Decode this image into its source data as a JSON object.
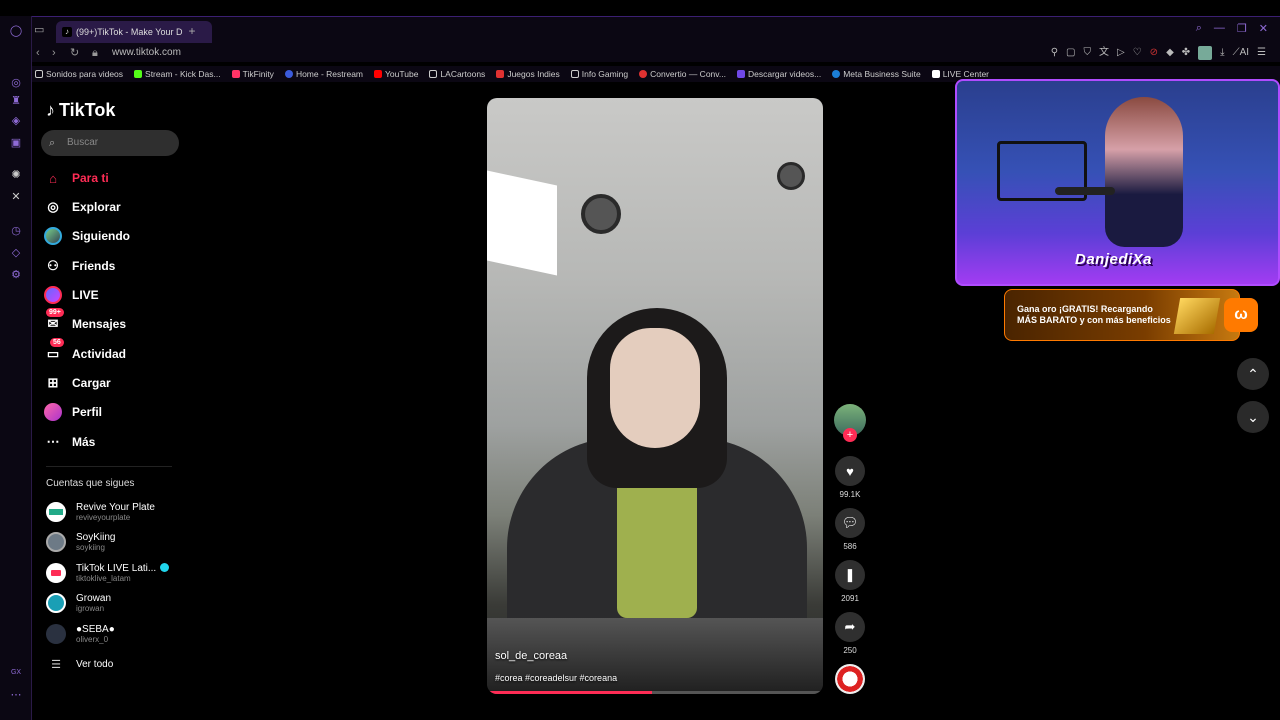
{
  "browser": {
    "tab_title": "(99+)TikTok - Make Your D",
    "url": "www.tiktok.com",
    "ai_label": "AI",
    "bookmarks": [
      {
        "label": "Sonidos para videos",
        "color": "#ccc"
      },
      {
        "label": "Stream - Kick Das...",
        "color": "#53fc18"
      },
      {
        "label": "TikFinity",
        "color": "#ff3366"
      },
      {
        "label": "Home - Restream",
        "color": "#3b5bdb"
      },
      {
        "label": "YouTube",
        "color": "#ff0000"
      },
      {
        "label": "LACartoons",
        "color": "#ccc"
      },
      {
        "label": "Juegos Indies",
        "color": "#e03131"
      },
      {
        "label": "Info Gaming",
        "color": "#ccc"
      },
      {
        "label": "Convertio — Conv...",
        "color": "#e03131"
      },
      {
        "label": "Descargar videos...",
        "color": "#7048e8"
      },
      {
        "label": "Meta Business Suite",
        "color": "#1c7ed6"
      },
      {
        "label": "LIVE Center",
        "color": "#ccc"
      }
    ]
  },
  "sidebar": {
    "logo": "TikTok",
    "search_placeholder": "Buscar",
    "nav": [
      {
        "label": "Para ti",
        "icon": "home-icon"
      },
      {
        "label": "Explorar",
        "icon": "compass-icon"
      },
      {
        "label": "Siguiendo",
        "icon": "following-avatar"
      },
      {
        "label": "Friends",
        "icon": "friends-icon"
      },
      {
        "label": "LIVE",
        "icon": "live-avatar"
      },
      {
        "label": "Mensajes",
        "icon": "messages-icon",
        "badge": "99+"
      },
      {
        "label": "Actividad",
        "icon": "activity-icon",
        "badge": "56"
      },
      {
        "label": "Cargar",
        "icon": "upload-icon"
      },
      {
        "label": "Perfil",
        "icon": "profile-avatar"
      },
      {
        "label": "Más",
        "icon": "more-icon"
      }
    ],
    "following_title": "Cuentas que sigues",
    "following": [
      {
        "name": "Revive Your Plate",
        "user": "reviveyourplate",
        "color": "#fff"
      },
      {
        "name": "SoyKiing",
        "user": "soykiing",
        "color": "#6d7a86"
      },
      {
        "name": "TikTok  LIVE  Lati...",
        "user": "tiktoklive_latam",
        "color": "#fff",
        "verified": true
      },
      {
        "name": "Growan",
        "user": "igrowan",
        "color": "#1a9fb5"
      },
      {
        "name": "●SEBA●",
        "user": "oliverx_0",
        "color": "#2a3140"
      }
    ],
    "see_all": "Ver todo"
  },
  "video": {
    "username": "sol_de_coreaa",
    "tags": "#corea #coreadelsur #coreana",
    "progress": 0.49
  },
  "actions": {
    "likes": "99.1K",
    "comments": "586",
    "saves": "2091",
    "shares": "250"
  },
  "overlay": {
    "streamer_name": "DanjediXa",
    "ad_text_line1": "Gana oro ¡GRATIS! Recargando",
    "ad_text_line2": "MÁS BARATO y con más beneficios"
  }
}
